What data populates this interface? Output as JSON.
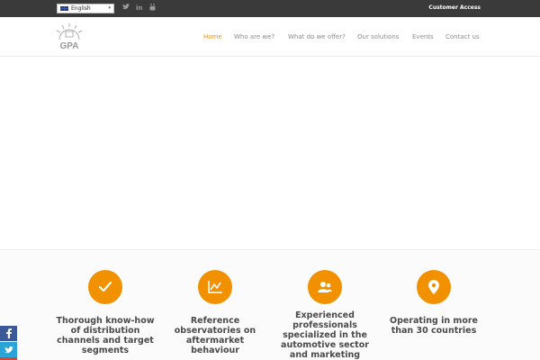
{
  "topbar": {
    "language": "English",
    "social": {
      "twitter": "twitter-icon",
      "linkedin": "in",
      "youtube": "youtube-icon"
    },
    "customer_access": "Customer Access"
  },
  "header": {
    "logo_text": "GPA",
    "nav": [
      "Home",
      "Who are we?",
      "What do we offer?",
      "Our solutions",
      "Events",
      "Contact us"
    ],
    "active_nav": "Home"
  },
  "features": [
    {
      "icon": "check-icon",
      "text": "Thorough know-how of distribution channels and target segments"
    },
    {
      "icon": "chart-line-icon",
      "text": "Reference observatories on aftermarket behaviour"
    },
    {
      "icon": "users-icon",
      "text": "Experienced professionals specialized in the automotive sector and marketing"
    },
    {
      "icon": "map-pin-icon",
      "text": "Operating in more than 30 countries"
    }
  ],
  "share": [
    "facebook-icon",
    "twitter-icon"
  ],
  "colors": {
    "accent": "#f29100",
    "nav_active": "#e0922a",
    "topbar": "#3a3a3a",
    "facebook": "#3b5998",
    "twitter": "#2aa3d7"
  }
}
